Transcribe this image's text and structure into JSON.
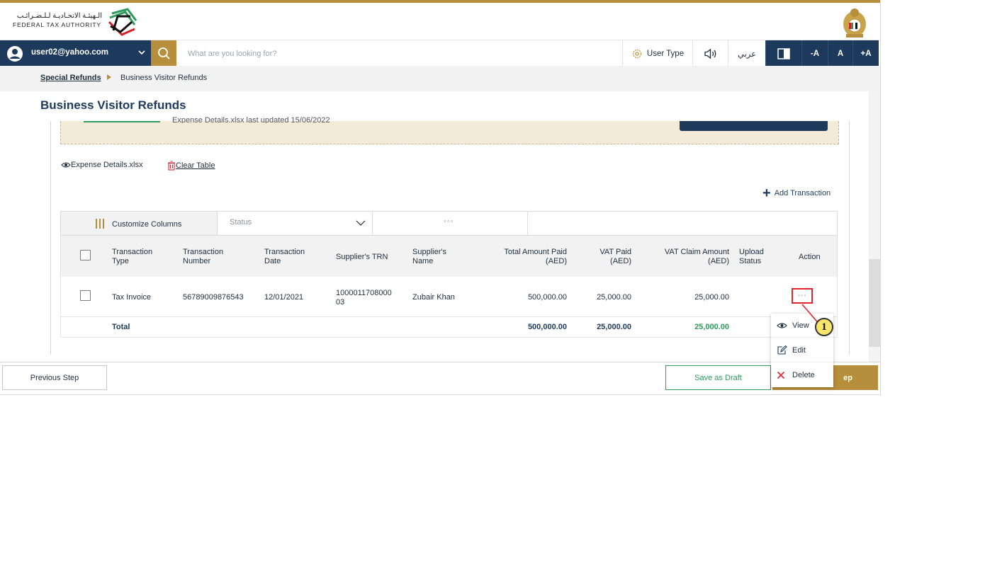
{
  "header": {
    "logo_ar": "الـهيئـة الاتحـاديـة لـلـضـرائـب",
    "logo_en": "FEDERAL TAX AUTHORITY"
  },
  "navbar": {
    "user_email": "user02@yahoo.com",
    "search_placeholder": "What are you looking for?",
    "user_type": "User Type",
    "language": "عربي",
    "font_decrease": "-A",
    "font_default": "A",
    "font_increase": "+A"
  },
  "breadcrumb": {
    "parent": "Special Refunds",
    "current": "Business Visitor Refunds"
  },
  "page": {
    "title": "Business Visitor Refunds",
    "banner_text": "Expense Details.xlsx last updated 15/06/2022"
  },
  "files": {
    "expense_file": "Expense Details.xlsx",
    "clear_table": "Clear Table",
    "add_transaction": "Add Transaction"
  },
  "toolbar": {
    "customize_columns": "Customize Columns",
    "status_placeholder": "Status",
    "more": "◦◦◦"
  },
  "table": {
    "headers": {
      "type": [
        "Transaction",
        "Type"
      ],
      "number": [
        "Transaction",
        "Number"
      ],
      "date": [
        "Transaction",
        "Date"
      ],
      "trn": "Supplier's TRN",
      "name": [
        "Supplier's",
        "Name"
      ],
      "total": [
        "Total Amount Paid",
        "(AED)"
      ],
      "vat": [
        "VAT Paid",
        "(AED)"
      ],
      "claim": [
        "VAT Claim Amount",
        "(AED)"
      ],
      "upload": [
        "Upload",
        "Status"
      ],
      "action": "Action"
    },
    "rows": [
      {
        "type": "Tax Invoice",
        "number": "56789009876543",
        "date": "12/01/2021",
        "trn": [
          "1000011708000",
          "03"
        ],
        "name": "Zubair Khan",
        "total": "500,000.00",
        "vat": "25,000.00",
        "claim": "25,000.00",
        "action": "◦◦◦"
      }
    ],
    "totals": {
      "label": "Total",
      "total": "500,000.00",
      "vat": "25,000.00",
      "claim": "25,000.00"
    }
  },
  "action_menu": {
    "view": "View",
    "edit": "Edit",
    "delete": "Delete"
  },
  "callout": "1",
  "footer": {
    "previous": "Previous Step",
    "save_draft": "Save as Draft",
    "next": "ep"
  },
  "colors": {
    "navy": "#1d3a5c",
    "gold": "#b78e3c",
    "green": "#2e9a5b",
    "highlight_red": "#e0252f"
  }
}
